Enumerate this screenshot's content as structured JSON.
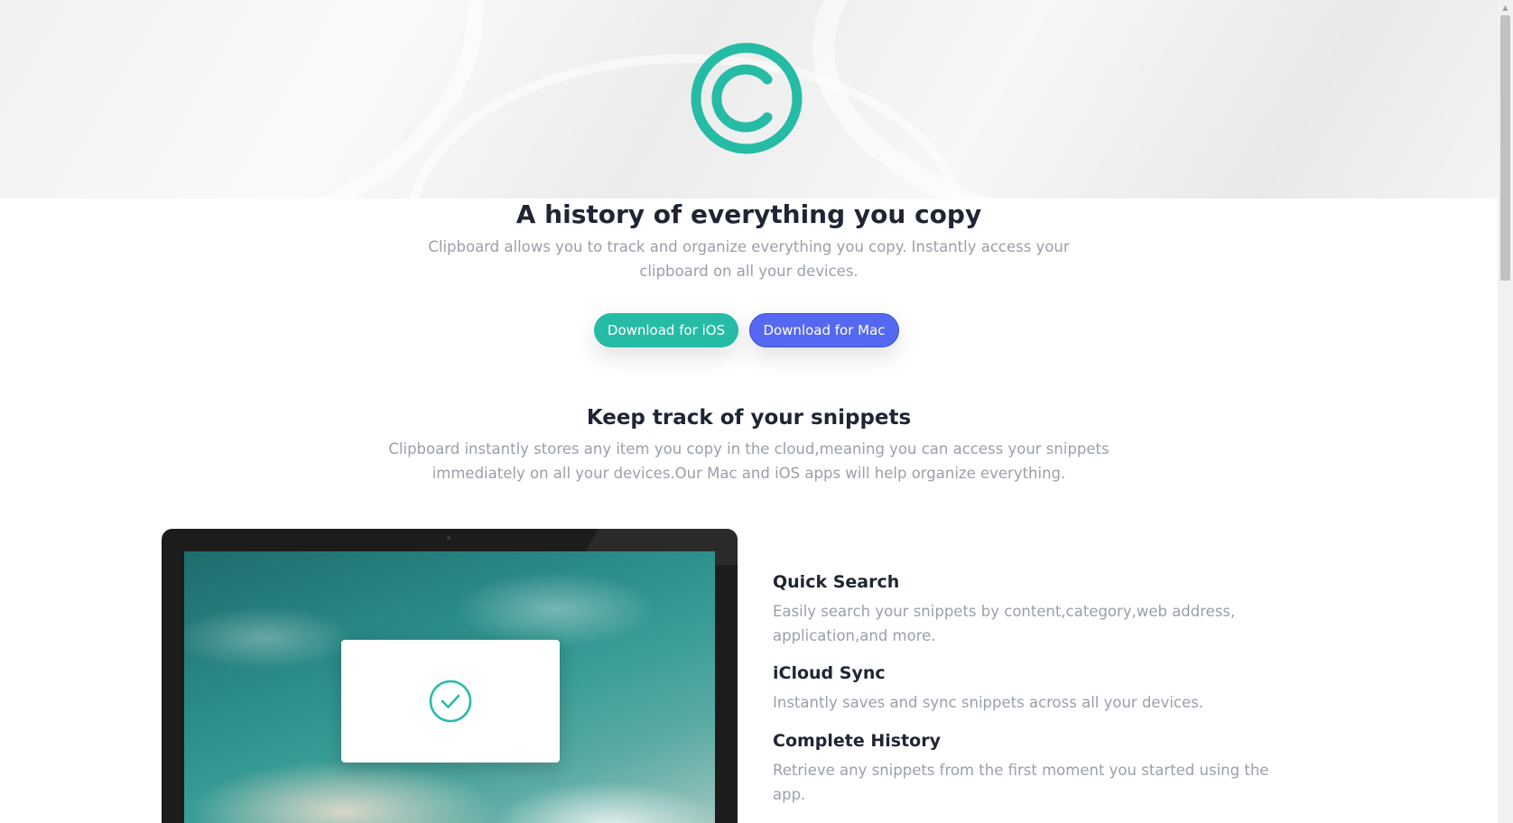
{
  "hero": {
    "logo_icon": "copyright-circle-icon",
    "accent_color": "#26bba4",
    "title": "A history of everything you copy",
    "subtitle": "Clipboard allows you to track and organize everything you copy. Instantly access your clipboard on all your devices.",
    "buttons": {
      "ios_label": "Download for iOS",
      "mac_label": "Download for Mac",
      "ios_color": "#26bba4",
      "mac_color": "#5468f1"
    }
  },
  "snippets": {
    "title": "Keep track of your snippets",
    "subtitle": "Clipboard instantly stores any item you copy in the cloud,meaning you can access your snippets immediately on all your devices.Our Mac and iOS apps will help organize everything."
  },
  "device": {
    "icon": "check-circle-icon"
  },
  "features": [
    {
      "title": "Quick Search",
      "description": "Easily search your snippets by content,category,web address, application,and more."
    },
    {
      "title": "iCloud Sync",
      "description": "Instantly saves and sync snippets across all your devices."
    },
    {
      "title": "Complete History",
      "description": "Retrieve any snippets from the first moment you started using the app."
    }
  ]
}
